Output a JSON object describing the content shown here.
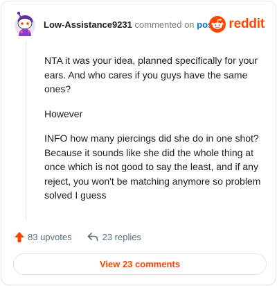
{
  "header": {
    "username": "Low-Assistance9231",
    "commented_text": "commented on",
    "post_link": "post",
    "brand": "reddit"
  },
  "comment": {
    "paragraphs": [
      "NTA it was your idea, planned specifically for your ears. And who cares if you guys have the same ones?",
      "However",
      "INFO how many piercings did she do in one shot? Because it sounds like she did the whole thing at once which is not good to say the least, and if any reject, you won't be matching anymore so problem solved I guess"
    ]
  },
  "actions": {
    "upvotes": "83 upvotes",
    "replies": "23 replies"
  },
  "footer": {
    "view_comments": "View 23 comments"
  },
  "icons": {
    "avatar": "snoo-avatar-icon",
    "brand_mark": "reddit-logo-icon",
    "upvote": "upvote-arrow-icon",
    "reply": "reply-arrow-icon"
  },
  "colors": {
    "brand": "#ff4500",
    "link": "#0079d3",
    "muted": "#576f76",
    "border": "#e3e4e6"
  }
}
